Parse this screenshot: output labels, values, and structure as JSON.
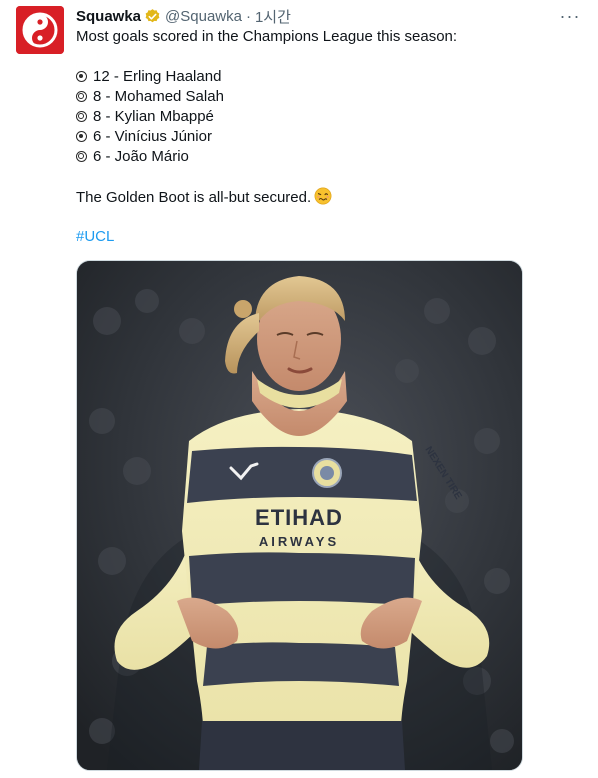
{
  "tweet": {
    "display_name": "Squawka",
    "handle": "@Squawka",
    "separator": "·",
    "timestamp": "1시간",
    "more_label": "···",
    "intro": "Most goals scored in the Champions League this season:",
    "ranking": [
      {
        "medal": "filled",
        "text": "12 - Erling Haaland"
      },
      {
        "medal": "ring",
        "text": "8 - Mohamed Salah"
      },
      {
        "medal": "ring",
        "text": "8 - Kylian Mbappé"
      },
      {
        "medal": "filled",
        "text": "6 - Vinícius Júnior"
      },
      {
        "medal": "ring",
        "text": "6 - João Mário"
      }
    ],
    "closing": "The Golden Boot is all-but secured.",
    "closing_emoji": "woozy-face-icon",
    "hashtag": "#UCL",
    "media": {
      "jersey_sponsor": "ETIHAD",
      "jersey_sponsor_sub": "AIRWAYS",
      "sleeve_text": "NEXEN TIRE"
    }
  },
  "colors": {
    "brand_red": "#d81f26",
    "link_blue": "#1d9bf0",
    "verified_gold": "#e2b719",
    "secondary_text": "#536471"
  }
}
